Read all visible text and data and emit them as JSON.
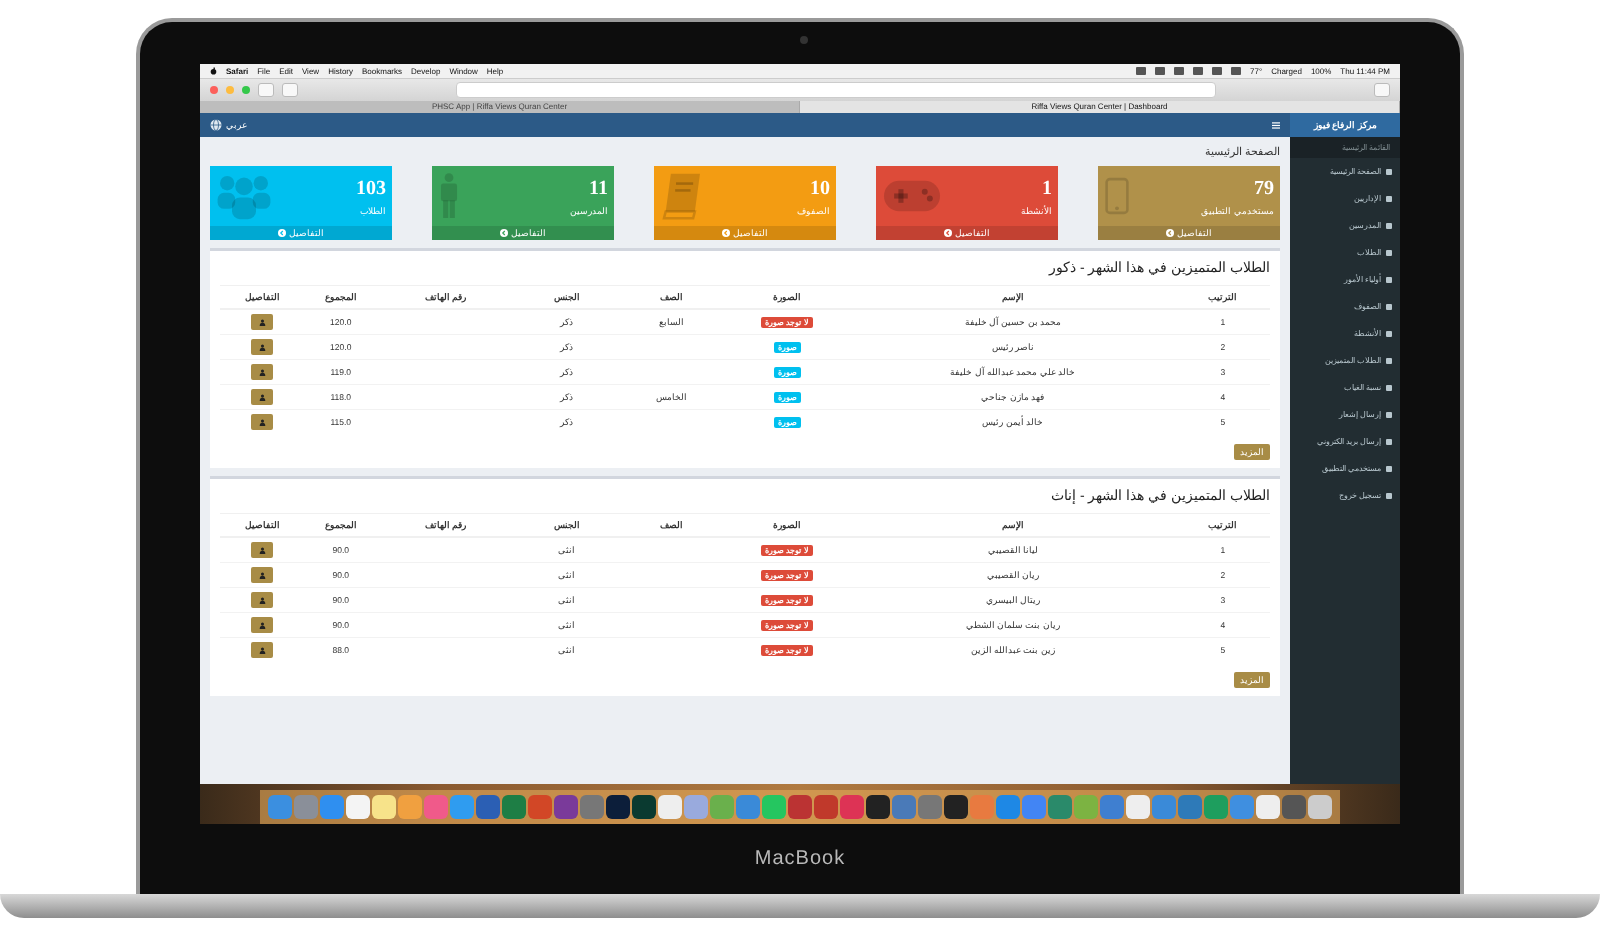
{
  "menu_bar": {
    "app": "Safari",
    "file": "File",
    "edit": "Edit",
    "view": "View",
    "history": "History",
    "bookmarks": "Bookmarks",
    "develop": "Develop",
    "window": "Window",
    "help": "Help",
    "temperature": "77°",
    "battery_state": "Charged",
    "battery_level": "100%",
    "clock": "Thu 11:44 PM"
  },
  "browser_tabs": {
    "left_tab": {
      "label": "PHSC App | Riffa Views Quran Center",
      "selected": false
    },
    "right_tab": {
      "label": "Riffa Views Quran Center | Dashboard",
      "selected": true
    }
  },
  "header": {
    "language": "عربي"
  },
  "sidebar": {
    "title": "مركز الرفاع فيوز",
    "section": "القائمة الرئيسية",
    "items": [
      "الصفحة الرئيسية",
      "الإداريين",
      "المدرسين",
      "الطلاب",
      "أولياء الأمور",
      "الصفوف",
      "الأنشطة",
      "الطلاب المتميزين",
      "نسبة الغياب",
      "إرسال إشعار",
      "إرسال بريد الكتروني",
      "مستخدمي التطبيق",
      "تسجيل خروج"
    ]
  },
  "page_title": "الصفحة الرئيسية",
  "stat_cards": [
    {
      "value": "79",
      "label": "مستخدمي التطبيق",
      "footer": "التفاصيل",
      "color": "#b0914a",
      "kind": "phone"
    },
    {
      "value": "1",
      "label": "الأنشطة",
      "footer": "التفاصيل",
      "color": "#dd4b39",
      "kind": "gamepad"
    },
    {
      "value": "10",
      "label": "الصفوف",
      "footer": "التفاصيل",
      "color": "#f39c12",
      "kind": "book"
    },
    {
      "value": "11",
      "label": "المدرسين",
      "footer": "التفاصيل",
      "color": "#3aa35a",
      "kind": "person"
    },
    {
      "value": "103",
      "label": "الطلاب",
      "footer": "التفاصيل",
      "color": "#00c0ef",
      "kind": "group"
    }
  ],
  "tables": [
    {
      "title": "الطلاب المتميزين في هذا الشهر - ذكور",
      "columns": [
        "الترتيب",
        "الإسم",
        "الصورة",
        "الصف",
        "الجنس",
        "رقم الهاتف",
        "المجموع",
        "التفاصيل"
      ],
      "more_button": "المزيد",
      "rows": [
        {
          "rank": "1",
          "name": "محمد بن حسين آل خليفة",
          "photo": {
            "label": "لا توجد صورة",
            "kind": "missing"
          },
          "grade": "السابع",
          "gender": "ذكر",
          "total": "120.0"
        },
        {
          "rank": "2",
          "name": "ناصر رئيس",
          "photo": {
            "label": "صورة",
            "kind": "present"
          },
          "gender": "ذكر",
          "total": "120.0"
        },
        {
          "rank": "3",
          "name": "خالد علي محمد عبدالله آل خليفة",
          "photo": {
            "label": "صورة",
            "kind": "present"
          },
          "gender": "ذكر",
          "total": "119.0"
        },
        {
          "rank": "4",
          "name": "فهد مازن جناحي",
          "photo": {
            "label": "صورة",
            "kind": "present"
          },
          "grade": "الخامس",
          "gender": "ذكر",
          "total": "118.0"
        },
        {
          "rank": "5",
          "name": "خالد أيمن رئيس",
          "photo": {
            "label": "صورة",
            "kind": "present"
          },
          "gender": "ذكر",
          "total": "115.0"
        }
      ]
    },
    {
      "title": "الطلاب المتميزين في هذا الشهر - إناث",
      "columns": [
        "الترتيب",
        "الإسم",
        "الصورة",
        "الصف",
        "الجنس",
        "رقم الهاتف",
        "المجموع",
        "التفاصيل"
      ],
      "more_button": "المزيد",
      "rows": [
        {
          "rank": "1",
          "name": "ليانا القصيبي",
          "photo": {
            "label": "لا توجد صورة",
            "kind": "missing"
          },
          "gender": "انثى",
          "total": "90.0"
        },
        {
          "rank": "2",
          "name": "ريان القصيبي",
          "photo": {
            "label": "لا توجد صورة",
            "kind": "missing"
          },
          "gender": "انثى",
          "total": "90.0"
        },
        {
          "rank": "3",
          "name": "ريتال البيسري",
          "photo": {
            "label": "لا توجد صورة",
            "kind": "missing"
          },
          "gender": "انثى",
          "total": "90.0"
        },
        {
          "rank": "4",
          "name": "ريان بنت سلمان الشطي",
          "photo": {
            "label": "لا توجد صورة",
            "kind": "missing"
          },
          "gender": "انثى",
          "total": "90.0"
        },
        {
          "rank": "5",
          "name": "زين بنت عبدالله الزين",
          "photo": {
            "label": "لا توجد صورة",
            "kind": "missing"
          },
          "gender": "انثى",
          "total": "88.0"
        }
      ]
    }
  ],
  "laptop": {
    "brand": "MacBook"
  }
}
